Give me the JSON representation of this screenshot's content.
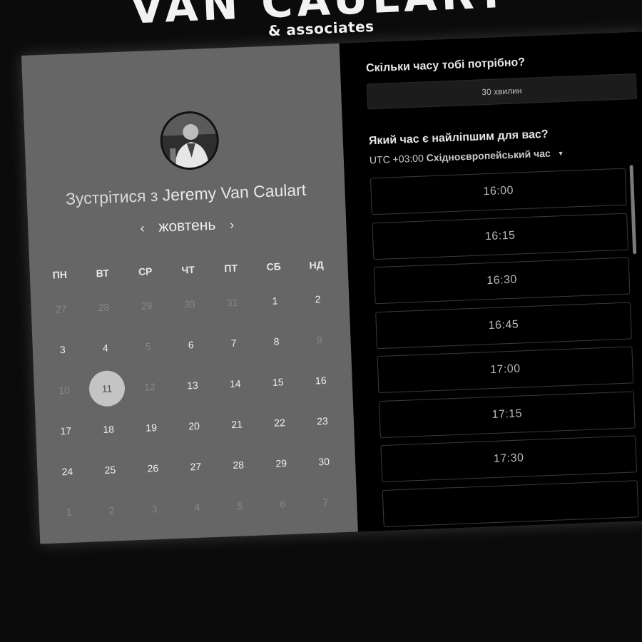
{
  "brand": {
    "name": "VAN CAULART",
    "subtitle": "& associates"
  },
  "host": {
    "title_prefix": "Зустрітися з",
    "name": "Jeremy Van Caulart"
  },
  "calendar": {
    "month": "жовтень",
    "prev_icon": "‹",
    "next_icon": "›",
    "weekdays": [
      "ПН",
      "ВТ",
      "СР",
      "ЧТ",
      "ПТ",
      "СБ",
      "НД"
    ],
    "weeks": [
      [
        "27",
        "28",
        "29",
        "30",
        "31",
        "1",
        "2"
      ],
      [
        "3",
        "4",
        "5",
        "6",
        "7",
        "8",
        "9"
      ],
      [
        "10",
        "11",
        "12",
        "13",
        "14",
        "15",
        "16"
      ],
      [
        "17",
        "18",
        "19",
        "20",
        "21",
        "22",
        "23"
      ],
      [
        "24",
        "25",
        "26",
        "27",
        "28",
        "29",
        "30"
      ],
      [
        "1",
        "2",
        "3",
        "4",
        "5",
        "6",
        "7"
      ]
    ],
    "selected": "11"
  },
  "duration": {
    "question": "Скільки часу тобі потрібно?",
    "value": "30 хвилин"
  },
  "time": {
    "question": "Який час є найліпшим для вас?",
    "tz_offset": "UTC +03:00",
    "tz_name": "Східноєвропейський час",
    "slots": [
      "16:00",
      "16:15",
      "16:30",
      "16:45",
      "17:00",
      "17:15",
      "17:30"
    ]
  },
  "colors": {
    "left_panel": "#666666",
    "right_panel": "#000000",
    "selected_day": "#c4c4c4"
  }
}
